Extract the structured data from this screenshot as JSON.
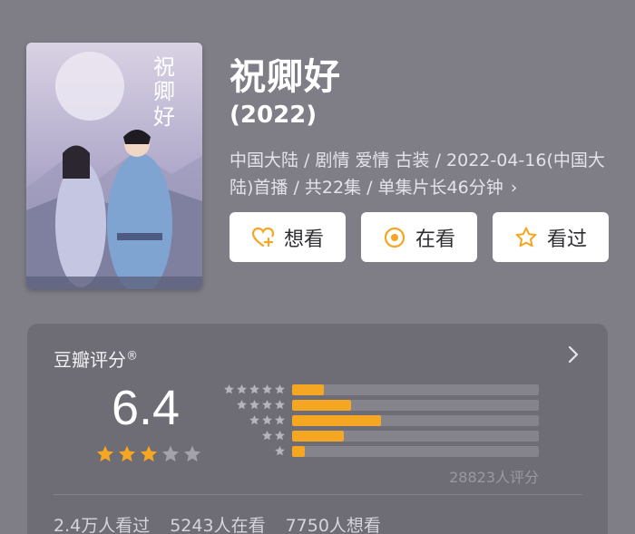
{
  "header": {
    "title": "祝卿好",
    "year": "(2022)",
    "meta_line": "中国大陆 / 剧情 爱情 古装 / 2022-04-16(中国大陆)首播 / 共22集 / 单集片长46分钟",
    "meta_chevron": "›"
  },
  "actions": [
    {
      "label": "想看",
      "icon": "heart-plus-icon"
    },
    {
      "label": "在看",
      "icon": "target-icon"
    },
    {
      "label": "看过",
      "icon": "star-outline-icon"
    }
  ],
  "rating": {
    "title": "豆瓣评分",
    "registered": "®",
    "score": "6.4",
    "stars_filled": 3,
    "stars_total": 5,
    "distribution": [
      {
        "stars": 5,
        "fraction": 0.13
      },
      {
        "stars": 4,
        "fraction": 0.24
      },
      {
        "stars": 3,
        "fraction": 0.36
      },
      {
        "stars": 2,
        "fraction": 0.21
      },
      {
        "stars": 1,
        "fraction": 0.05
      }
    ],
    "count_label": "28823人评分",
    "stats": [
      "2.4万人看过",
      "5243人在看",
      "7750人想看"
    ]
  },
  "colors": {
    "background": "#7f7d86",
    "card": "#6e6c75",
    "accent": "#f5a623",
    "star_empty": "#a3a1a9"
  }
}
